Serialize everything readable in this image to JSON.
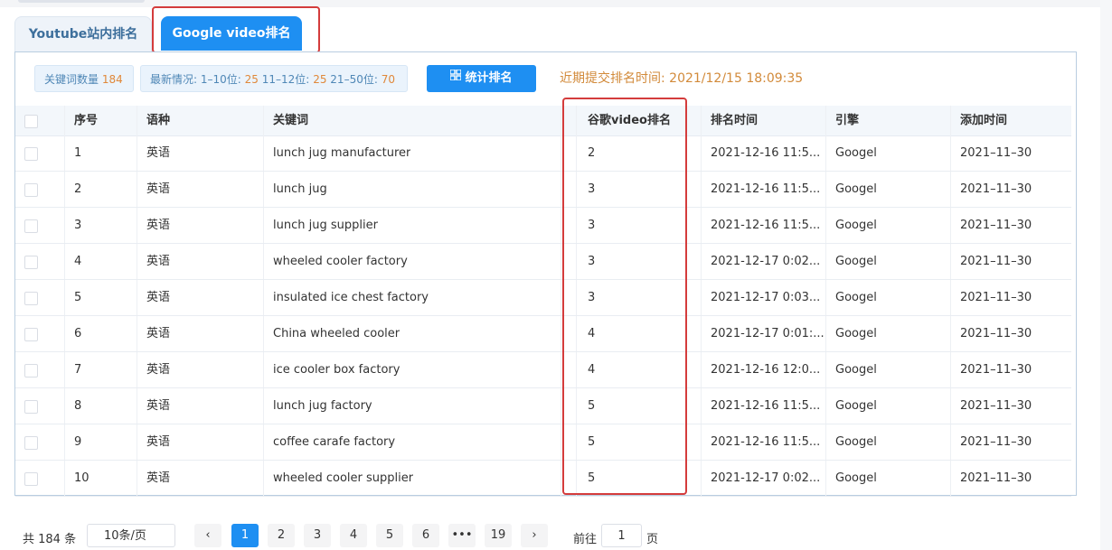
{
  "tabs": [
    {
      "label": "Youtube站内排名",
      "active": false
    },
    {
      "label": "Google video排名",
      "active": true
    }
  ],
  "summary": {
    "keyword_count_label": "关键词数量",
    "keyword_count": "184",
    "status_label": "最新情况:",
    "range1_label": "1–10位:",
    "range1_value": "25",
    "range2_label": "11–12位:",
    "range2_value": "25",
    "range3_label": "21–50位:",
    "range3_value": "70",
    "stat_button": "统计排名",
    "submit_label": "近期提交排名时间:",
    "submit_time": "2021/12/15 18:09:35"
  },
  "table": {
    "headers": {
      "seq": "序号",
      "lang": "语种",
      "keyword": "关键词",
      "rank": "谷歌video排名",
      "rank_time": "排名时间",
      "engine": "引擎",
      "added": "添加时间"
    },
    "rows": [
      {
        "seq": "1",
        "lang": "英语",
        "keyword": "lunch jug manufacturer",
        "rank": "2",
        "rank_time": "2021-12-16 11:5...",
        "engine": "Googel",
        "added": "2021–11–30"
      },
      {
        "seq": "2",
        "lang": "英语",
        "keyword": "lunch jug",
        "rank": "3",
        "rank_time": "2021-12-16 11:5...",
        "engine": "Googel",
        "added": "2021–11–30"
      },
      {
        "seq": "3",
        "lang": "英语",
        "keyword": "lunch jug supplier",
        "rank": "3",
        "rank_time": "2021-12-16 11:5...",
        "engine": "Googel",
        "added": "2021–11–30"
      },
      {
        "seq": "4",
        "lang": "英语",
        "keyword": "wheeled cooler factory",
        "rank": "3",
        "rank_time": "2021-12-17 0:02...",
        "engine": "Googel",
        "added": "2021–11–30"
      },
      {
        "seq": "5",
        "lang": "英语",
        "keyword": "insulated ice chest factory",
        "rank": "3",
        "rank_time": "2021-12-17 0:03...",
        "engine": "Googel",
        "added": "2021–11–30"
      },
      {
        "seq": "6",
        "lang": "英语",
        "keyword": "China wheeled cooler",
        "rank": "4",
        "rank_time": "2021-12-17 0:01:...",
        "engine": "Googel",
        "added": "2021–11–30"
      },
      {
        "seq": "7",
        "lang": "英语",
        "keyword": "ice cooler box factory",
        "rank": "4",
        "rank_time": "2021-12-16 12:0...",
        "engine": "Googel",
        "added": "2021–11–30"
      },
      {
        "seq": "8",
        "lang": "英语",
        "keyword": "lunch jug factory",
        "rank": "5",
        "rank_time": "2021-12-16 11:5...",
        "engine": "Googel",
        "added": "2021–11–30"
      },
      {
        "seq": "9",
        "lang": "英语",
        "keyword": "coffee carafe factory",
        "rank": "5",
        "rank_time": "2021-12-16 11:5...",
        "engine": "Googel",
        "added": "2021–11–30"
      },
      {
        "seq": "10",
        "lang": "英语",
        "keyword": "wheeled cooler supplier",
        "rank": "5",
        "rank_time": "2021-12-17 0:02...",
        "engine": "Googel",
        "added": "2021–11–30"
      }
    ]
  },
  "pagination": {
    "total": "共 184 条",
    "page_size": "10条/页",
    "prev": "‹",
    "next": "›",
    "pages": [
      "1",
      "2",
      "3",
      "4",
      "5",
      "6",
      "•••",
      "19"
    ],
    "current_page": "1",
    "goto_label": "前往",
    "goto_value": "1",
    "page_suffix": "页"
  },
  "colors": {
    "primary": "#1e8ff2",
    "highlight_outline": "#d43c3c",
    "count_accent": "#e0883a",
    "submit_text": "#d28a3a"
  }
}
